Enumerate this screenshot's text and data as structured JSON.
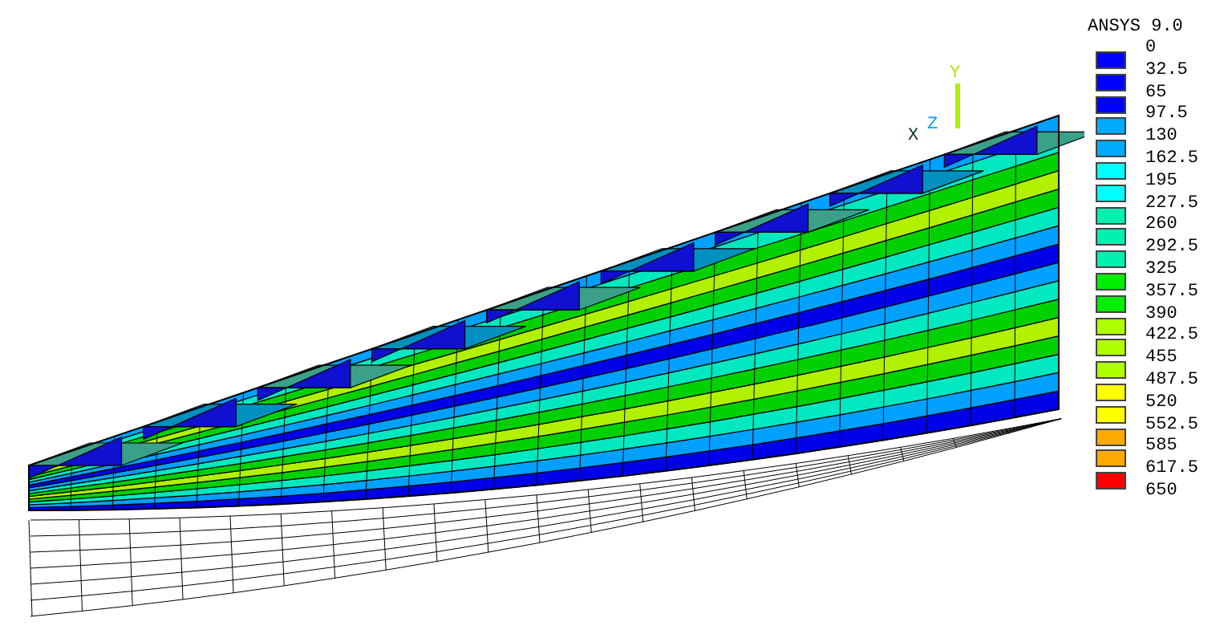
{
  "title": "ANSYS 9.0",
  "axis_triad": [
    {
      "label": "Y"
    },
    {
      "label": "Z"
    },
    {
      "label": "X"
    }
  ],
  "legend": {
    "labels": [
      "0",
      "32.5",
      "65",
      "97.5",
      "130",
      "162.5",
      "195",
      "227.5",
      "260",
      "292.5",
      "325",
      "357.5",
      "390",
      "422.5",
      "455",
      "487.5",
      "520",
      "552.5",
      "585",
      "617.5",
      "650"
    ],
    "swatches": [
      {
        "color": "#0000ff"
      },
      {
        "color": "#0000ff"
      },
      {
        "color": "#0000ff"
      },
      {
        "color": "#00aaff"
      },
      {
        "color": "#00aaff"
      },
      {
        "color": "#00ffff"
      },
      {
        "color": "#00ffff"
      },
      {
        "color": "#00f0b0"
      },
      {
        "color": "#00f0b0"
      },
      {
        "color": "#00f0b0"
      },
      {
        "color": "#00ee00"
      },
      {
        "color": "#00ee00"
      },
      {
        "color": "#b0ff00"
      },
      {
        "color": "#b0ff00"
      },
      {
        "color": "#b0ff00"
      },
      {
        "color": "#ffff00"
      },
      {
        "color": "#ffff00"
      },
      {
        "color": "#ffaa00"
      },
      {
        "color": "#ffaa00"
      },
      {
        "color": "#ff0000"
      }
    ]
  }
}
